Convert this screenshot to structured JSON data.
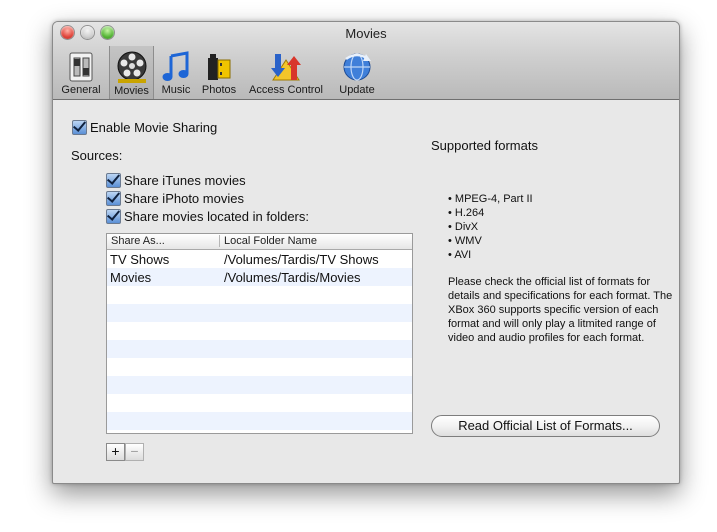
{
  "window": {
    "title": "Movies",
    "toolbar": [
      {
        "label": "General",
        "icon": "general-switch-icon"
      },
      {
        "label": "Movies",
        "icon": "film-reel-icon",
        "selected": true
      },
      {
        "label": "Music",
        "icon": "music-note-icon"
      },
      {
        "label": "Photos",
        "icon": "film-canister-icon"
      },
      {
        "label": "Access Control",
        "icon": "access-control-arrows-icon"
      },
      {
        "label": "Update",
        "icon": "update-globe-icon"
      }
    ]
  },
  "settings": {
    "enable_movie_sharing": {
      "label": "Enable Movie Sharing",
      "checked": true
    },
    "sources_label": "Sources:",
    "share_itunes": {
      "label": "Share iTunes movies",
      "checked": true
    },
    "share_iphoto": {
      "label": "Share iPhoto movies",
      "checked": true
    },
    "share_folders": {
      "label": "Share movies located in folders:",
      "checked": true
    }
  },
  "folders_table": {
    "columns": [
      "Share As...",
      "Local Folder Name"
    ],
    "rows": [
      {
        "share_as": "TV Shows",
        "folder": "/Volumes/Tardis/TV Shows"
      },
      {
        "share_as": "Movies",
        "folder": "/Volumes/Tardis/Movies"
      }
    ]
  },
  "buttons": {
    "add": "+",
    "remove": "−",
    "read_formats": "Read Official List of Formats..."
  },
  "formats": {
    "heading": "Supported formats",
    "items": [
      "MPEG-4, Part II",
      "H.264",
      "DivX",
      "WMV",
      "AVI"
    ],
    "note": "Please check the official list of formats for details and specifications for each format.  The XBox 360 supports specific version of each format and will only play a litmited range of video and audio profiles for each format."
  }
}
